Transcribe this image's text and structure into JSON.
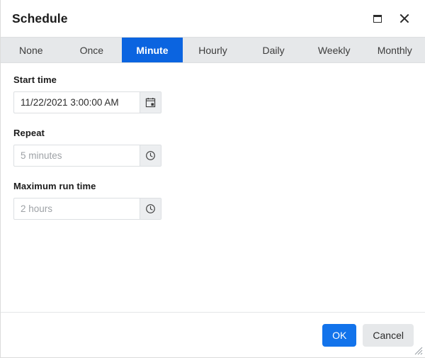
{
  "window": {
    "title": "Schedule",
    "maximize_icon": "maximize-icon",
    "close_icon": "close-icon"
  },
  "tabs": [
    {
      "id": "none",
      "label": "None",
      "active": false
    },
    {
      "id": "once",
      "label": "Once",
      "active": false
    },
    {
      "id": "minute",
      "label": "Minute",
      "active": true
    },
    {
      "id": "hourly",
      "label": "Hourly",
      "active": false
    },
    {
      "id": "daily",
      "label": "Daily",
      "active": false
    },
    {
      "id": "weekly",
      "label": "Weekly",
      "active": false
    },
    {
      "id": "monthly",
      "label": "Monthly",
      "active": false
    }
  ],
  "fields": {
    "start_time": {
      "label": "Start time",
      "value": "11/22/2021 3:00:00 AM",
      "placeholder": "",
      "icon": "calendar-icon"
    },
    "repeat": {
      "label": "Repeat",
      "value": "",
      "placeholder": "5 minutes",
      "icon": "clock-icon"
    },
    "maximum_run_time": {
      "label": "Maximum run time",
      "value": "",
      "placeholder": "2 hours",
      "icon": "clock-icon"
    }
  },
  "footer": {
    "ok_label": "OK",
    "cancel_label": "Cancel"
  },
  "colors": {
    "accent": "#1273eb",
    "active_tab": "#0b64e0",
    "tabstrip_bg": "#e6e8ea",
    "secondary_button": "#e6e8ea",
    "text": "#1b1b1b",
    "placeholder": "#9ea2a6"
  }
}
